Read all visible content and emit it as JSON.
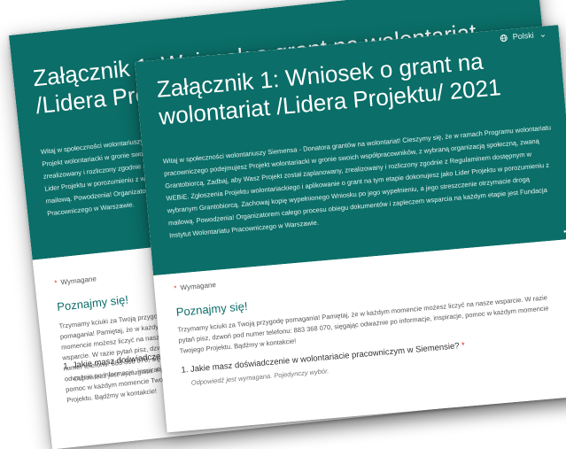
{
  "language": {
    "label": "Polski",
    "icon": "globe-icon"
  },
  "form": {
    "title": "Załącznik 1: Wniosek o grant na wolontariat /Lidera Projektu/ 2021",
    "intro": "Witaj w społeczności wolontariuszy Siemensa - Donatora grantów na wolontariat! Cieszymy się, że w ramach Programu wolontariatu pracowniczego podejmujesz Projekt wolontariacki w gronie swoich współpracowników, z wybraną organizacją społeczną, zwaną Grantobiorcą. Zadbaj, aby Wasz Projekt został zaplanowany, zrealizowany i rozliczony zgodnie z Regulaminem dostępnym w WEBiE. Zgłoszenia Projektu wolontariackiego i aplikowanie o grant na tym etapie dokonujesz jako Lider Projektu w porozumieniu z wybranym Grantobiorcą. Zachowaj kopię wypełnionego Wniosku po jego wypełnieniu, a jego streszczenie otrzymacie drogą mailową. Powodzenia! Organizatorem całego procesu obiegu dokumentów i zapleczem wsparcia na każdym etapie jest Fundacja Instytut Wolontariatu Pracowniczego w Warszawie.",
    "required_label": "Wymagane",
    "section_title": "Poznajmy się!",
    "section_text": "Trzymamy kciuki za Twoją przygodę pomagania! Pamiętaj, że w każdym momencie możesz liczyć na nasze wsparcie. W razie pytań pisz, dzwoń pod numer telefonu: 883 368 070, sięgając odważnie po informacje, inspiracje, pomoc w każdym momencie Twojego Projektu. Bądźmy w kontakcie!",
    "question": "1. Jakie masz doświadczenie w wolontariacie pracowniczym w Siemensie?",
    "question_hint": "Odpowiedź jest wymagana. Pojedynczy wybór."
  },
  "colors": {
    "header": "#0b6e68",
    "required": "#d93025"
  }
}
